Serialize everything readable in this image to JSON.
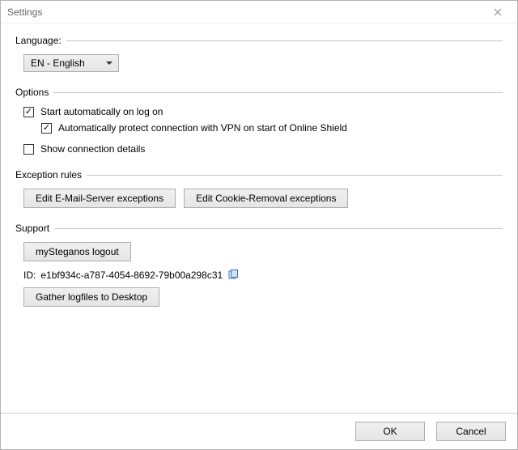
{
  "window": {
    "title": "Settings"
  },
  "language": {
    "label": "Language:",
    "value": "EN - English"
  },
  "options": {
    "label": "Options",
    "start_auto": {
      "label": "Start automatically on log on",
      "checked": true
    },
    "auto_protect": {
      "label": "Automatically protect connection with VPN on start of Online Shield",
      "checked": true
    },
    "show_details": {
      "label": "Show connection details",
      "checked": false
    }
  },
  "exception_rules": {
    "label": "Exception rules",
    "email_btn": "Edit E-Mail-Server exceptions",
    "cookie_btn": "Edit Cookie-Removal exceptions"
  },
  "support": {
    "label": "Support",
    "logout_btn": "mySteganos logout",
    "id_prefix": "ID:",
    "id_value": "e1bf934c-a787-4054-8692-79b00a298c31",
    "gather_btn": "Gather logfiles to Desktop"
  },
  "footer": {
    "ok": "OK",
    "cancel": "Cancel"
  }
}
